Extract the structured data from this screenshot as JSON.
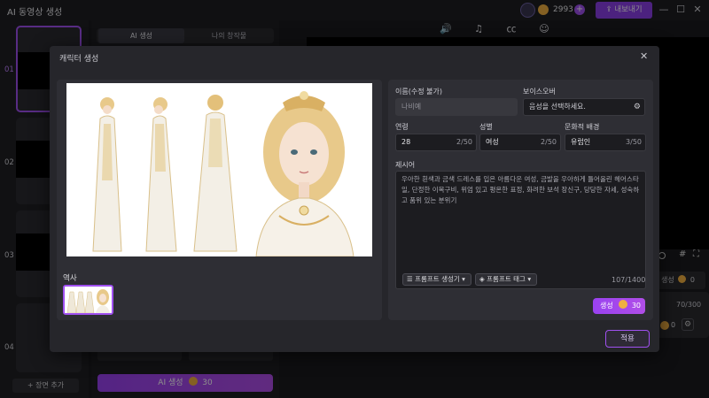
{
  "app": {
    "title": "AI 동영상 생성",
    "credits": "2993",
    "export_label": "내보내기",
    "window_controls": [
      "minimize-icon",
      "maximize-icon",
      "close-icon"
    ]
  },
  "scenes": {
    "items": [
      {
        "number": "01",
        "selected": true
      },
      {
        "number": "02",
        "selected": false
      },
      {
        "number": "03",
        "selected": false
      },
      {
        "number": "04",
        "selected": false
      }
    ],
    "add_label": "장면 추가"
  },
  "middle": {
    "tabs": [
      {
        "label": "AI 생성",
        "active": true
      },
      {
        "label": "나의 창작물",
        "active": false
      }
    ],
    "field_a": "",
    "field_b": "",
    "generate_label": "AI 생성",
    "generate_cost": "30"
  },
  "right": {
    "toolbar_icons": [
      "voice-icon",
      "music-icon",
      "subtitle-icon",
      "avatar-icon"
    ],
    "small_btn_label": "생성",
    "small_btn_cost": "0",
    "card_count": "70/300",
    "card_cost": "0"
  },
  "modal": {
    "title": "캐릭터 생성",
    "history_label": "역사",
    "name_label": "이름(수정 불가)",
    "name_value": "나비예",
    "voice_label": "보이스오버",
    "voice_placeholder": "음성을 선택하세요.",
    "age_label": "연령",
    "age_value": "28",
    "age_count": "2/50",
    "gender_label": "성별",
    "gender_value": "여성",
    "gender_count": "2/50",
    "culture_label": "문화적 배경",
    "culture_value": "유럽인",
    "culture_count": "3/50",
    "prompt_label": "제시어",
    "prompt_text": "우아한 흰색과 금색 드레스를 입은 아름다운 여성, 금발을 우아하게 틀어올린 헤어스타일, 단정한 이목구비, 위엄 있고 평온한 표정, 화려한 보석 장신구, 당당한 자세, 성숙하고 품위 있는 분위기",
    "prompt_generator_label": "프롬프트 생성기",
    "prompt_tag_label": "프롬프트 태그",
    "prompt_count": "107/1400",
    "generate_label": "생성",
    "generate_cost": "30",
    "apply_label": "적용"
  },
  "colors": {
    "accent": "#a050f0",
    "coin": "#f0b040",
    "panel": "#2e2e34"
  }
}
